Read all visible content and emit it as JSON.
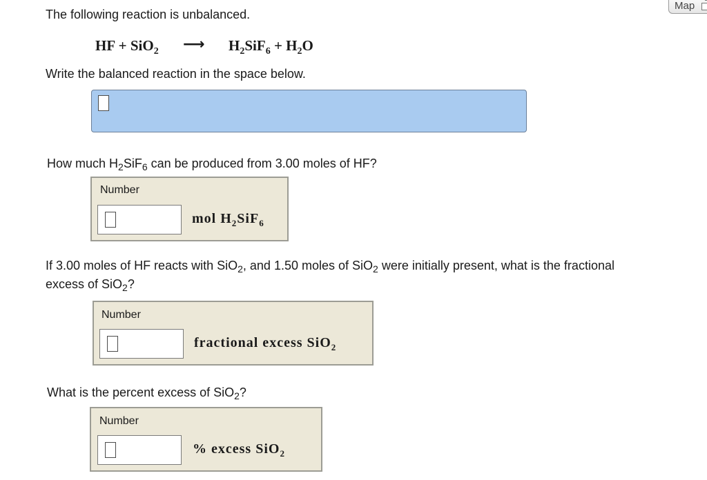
{
  "map_button": {
    "label": "Map"
  },
  "intro": "The following reaction is unbalanced.",
  "reaction": {
    "reactant1": "HF",
    "plus1": "+",
    "reactant2_base": "SiO",
    "reactant2_sub": "2",
    "arrow": "⟶",
    "product1_h": "H",
    "product1_h_sub": "2",
    "product1_mid": "SiF",
    "product1_f_sub": "6",
    "plus2": "+",
    "product2_h": "H",
    "product2_h_sub": "2",
    "product2_o": "O"
  },
  "instruction": "Write the balanced reaction in the space below.",
  "q1": {
    "text_pre": "How much H",
    "sub1": "2",
    "text_mid": "SiF",
    "sub2": "6",
    "text_post": " can be produced from 3.00 moles of HF?",
    "panel_label": "Number",
    "input_value": "",
    "unit_pre": "mol  H",
    "unit_sub1": "2",
    "unit_mid": "SiF",
    "unit_sub2": "6"
  },
  "q2": {
    "line1_pre": "If 3.00 moles of HF reacts with SiO",
    "line1_sub1": "2",
    "line1_mid": ", and 1.50 moles of SiO",
    "line1_sub2": "2",
    "line1_post": " were initially present, what is the fractional",
    "line2_pre": "excess of SiO",
    "line2_sub": "2",
    "line2_post": "?",
    "panel_label": "Number",
    "input_value": "",
    "unit_pre": "fractional  excess  SiO",
    "unit_sub": "2"
  },
  "q3": {
    "text_pre": "What is the percent excess of SiO",
    "sub": "2",
    "text_post": "?",
    "panel_label": "Number",
    "input_value": "",
    "unit_pre": "%   excess  SiO",
    "unit_sub": "2"
  },
  "colors": {
    "equation_box_bg": "#a9cbf0",
    "panel_bg": "#ece8d8",
    "panel_border": "#9c9c94"
  }
}
